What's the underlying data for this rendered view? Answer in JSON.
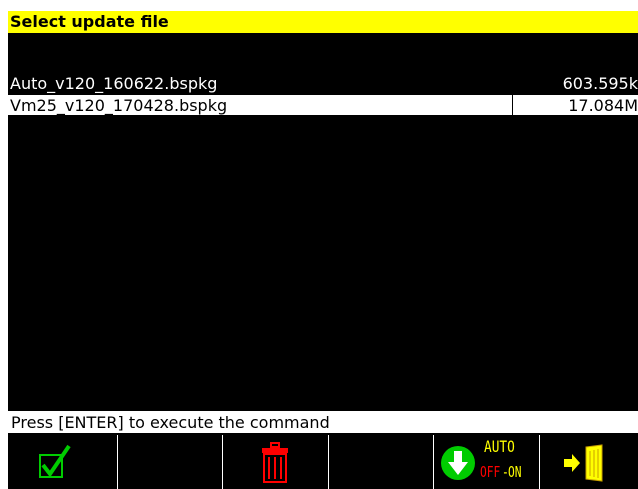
{
  "window": {
    "title": "Select update file"
  },
  "files": [
    {
      "name": "Auto_v120_160622.bspkg",
      "size": "603.595k",
      "selected": false
    },
    {
      "name": "Vm25_v120_170428.bspkg",
      "size": "17.084M",
      "selected": true
    }
  ],
  "status": {
    "text": "Press [ENTER] to execute the command"
  },
  "function_keys": [
    {
      "icon": "checkmark-icon"
    },
    {
      "icon": ""
    },
    {
      "icon": "trash-icon"
    },
    {
      "icon": ""
    },
    {
      "icon": "download-auto-icon",
      "top_text": "AUTO",
      "bottom_off": "OFF",
      "bottom_on": "ON"
    },
    {
      "icon": "exit-door-icon"
    }
  ],
  "colors": {
    "title_bg": "#ffff00",
    "screen_bg": "#000000",
    "check": "#00cc00",
    "trash": "#ff0000",
    "download": "#00cc00",
    "auto_on": "#ffff00",
    "auto_off": "#ff0000",
    "exit_arrow": "#ffff00"
  }
}
